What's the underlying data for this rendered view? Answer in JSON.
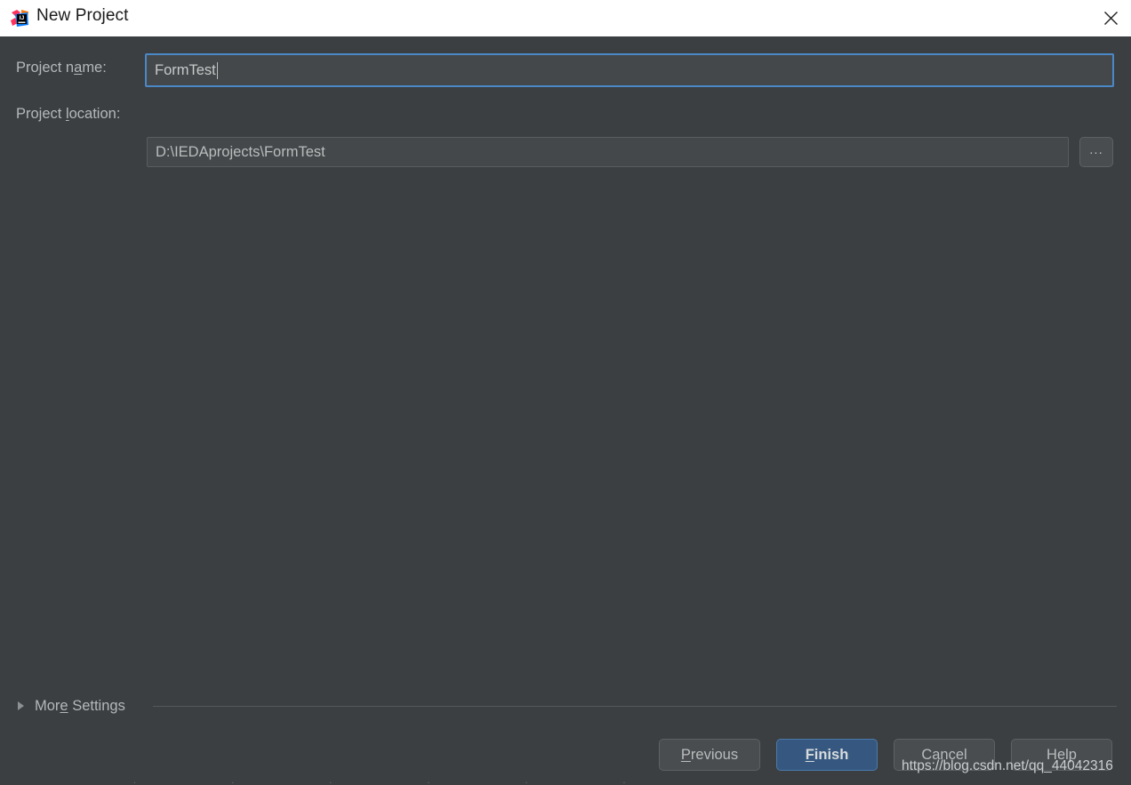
{
  "window": {
    "title": "New Project",
    "app_icon": "intellij-idea-icon",
    "close_icon": "close-icon",
    "background_color": "#3c3f41",
    "titlebar_color": "#ffffff"
  },
  "form": {
    "project_name": {
      "label": "Project name:",
      "label_prefix": "Project n",
      "label_mnemonic": "a",
      "label_suffix": "me:",
      "value": "FormTest",
      "focused": true,
      "focus_color": "#4a88c7"
    },
    "project_location": {
      "label": "Project location:",
      "label_prefix": "Project ",
      "label_mnemonic": "l",
      "label_suffix": "ocation:",
      "value": "D:\\IEDAprojects\\FormTest",
      "browse_label": "...",
      "browse_icon": "ellipsis-icon"
    }
  },
  "more_settings": {
    "label": "More Settings",
    "label_prefix": "Mor",
    "label_mnemonic": "e",
    "label_suffix": " Settings",
    "expanded": false,
    "arrow_icon": "triangle-right-icon"
  },
  "buttons": {
    "previous": {
      "label": "Previous",
      "mnemonic": "P",
      "label_rest": "revious",
      "default": false
    },
    "finish": {
      "label": "Finish",
      "mnemonic": "F",
      "label_rest": "inish",
      "default": true,
      "color": "#365880"
    },
    "cancel": {
      "label": "Cancel",
      "default": false
    },
    "help": {
      "label": "Help",
      "default": false
    }
  },
  "watermark": {
    "text": "https://blog.csdn.net/qq_44042316"
  },
  "bottom_strip": {
    "text": ". . . . . ."
  }
}
